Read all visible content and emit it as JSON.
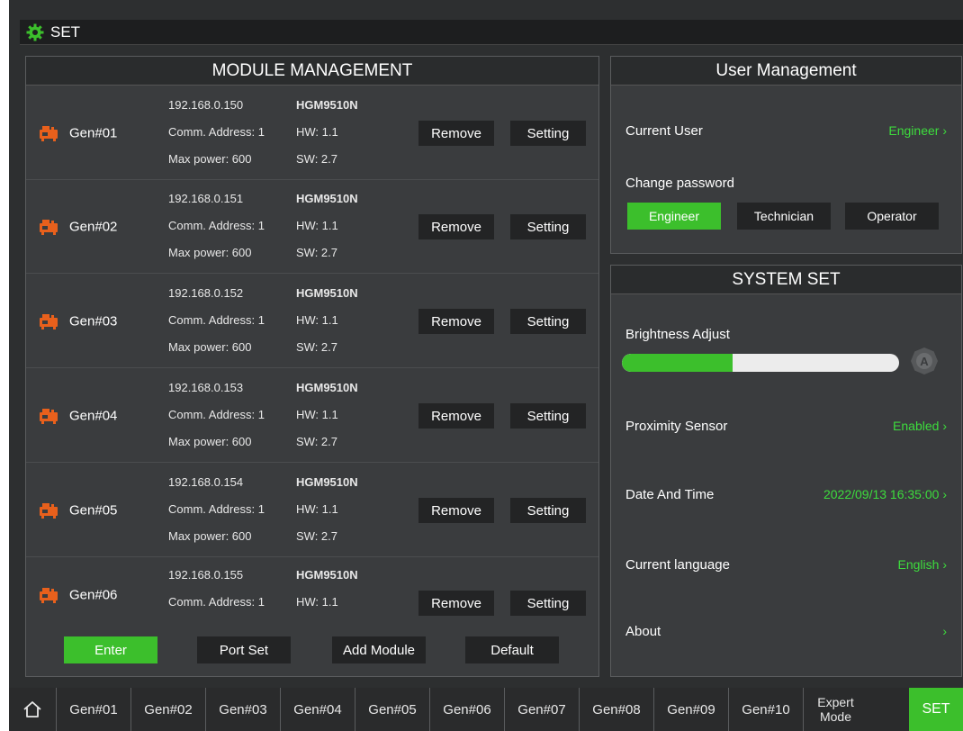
{
  "topbar": {
    "title": "SET"
  },
  "module": {
    "title": "MODULE MANAGEMENT",
    "rows": [
      {
        "name": "Gen#01",
        "ip": "192.168.0.150",
        "comm": "Comm. Address: 1",
        "power": "Max power: 600",
        "model": "HGM9510N",
        "hw": "HW: 1.1",
        "sw": "SW: 2.7"
      },
      {
        "name": "Gen#02",
        "ip": "192.168.0.151",
        "comm": "Comm. Address: 1",
        "power": "Max power: 600",
        "model": "HGM9510N",
        "hw": "HW: 1.1",
        "sw": "SW: 2.7"
      },
      {
        "name": "Gen#03",
        "ip": "192.168.0.152",
        "comm": "Comm. Address: 1",
        "power": "Max power: 600",
        "model": "HGM9510N",
        "hw": "HW: 1.1",
        "sw": "SW: 2.7"
      },
      {
        "name": "Gen#04",
        "ip": "192.168.0.153",
        "comm": "Comm. Address: 1",
        "power": "Max power: 600",
        "model": "HGM9510N",
        "hw": "HW: 1.1",
        "sw": "SW: 2.7"
      },
      {
        "name": "Gen#05",
        "ip": "192.168.0.154",
        "comm": "Comm. Address: 1",
        "power": "Max power: 600",
        "model": "HGM9510N",
        "hw": "HW: 1.1",
        "sw": "SW: 2.7"
      },
      {
        "name": "Gen#06",
        "ip": "192.168.0.155",
        "comm": "Comm. Address: 1",
        "model": "HGM9510N",
        "hw": "HW: 1.1"
      }
    ],
    "remove_label": "Remove",
    "setting_label": "Setting",
    "enter_label": "Enter",
    "portset_label": "Port Set",
    "addmodule_label": "Add Module",
    "default_label": "Default"
  },
  "user": {
    "title": "User Management",
    "current_user_label": "Current User",
    "current_user_value": "Engineer",
    "chevron": "›",
    "change_password_label": "Change password",
    "engineer_label": "Engineer",
    "technician_label": "Technician",
    "operator_label": "Operator"
  },
  "system": {
    "title": "SYSTEM SET",
    "brightness_label": "Brightness Adjust",
    "brightness_level": 0.4,
    "proximity_label": "Proximity Sensor",
    "proximity_value": "Enabled",
    "datetime_label": "Date And Time",
    "datetime_value": "2022/09/13 16:35:00",
    "language_label": "Current language",
    "language_value": "English",
    "about_label": "About",
    "chevron": "›"
  },
  "nav": {
    "items": [
      "Gen#01",
      "Gen#02",
      "Gen#03",
      "Gen#04",
      "Gen#05",
      "Gen#06",
      "Gen#07",
      "Gen#08",
      "Gen#09",
      "Gen#10"
    ],
    "expert_line1": "Expert",
    "expert_line2": "Mode",
    "set_label": "SET"
  },
  "colors": {
    "accent": "#3cbf2c",
    "value_text": "#3ddc3d",
    "generator_icon": "#e8601c"
  },
  "icons": {
    "topbar": "gear-icon",
    "module": "generator-icon",
    "auto_brightness": "auto-brightness-icon",
    "home": "home-icon"
  }
}
